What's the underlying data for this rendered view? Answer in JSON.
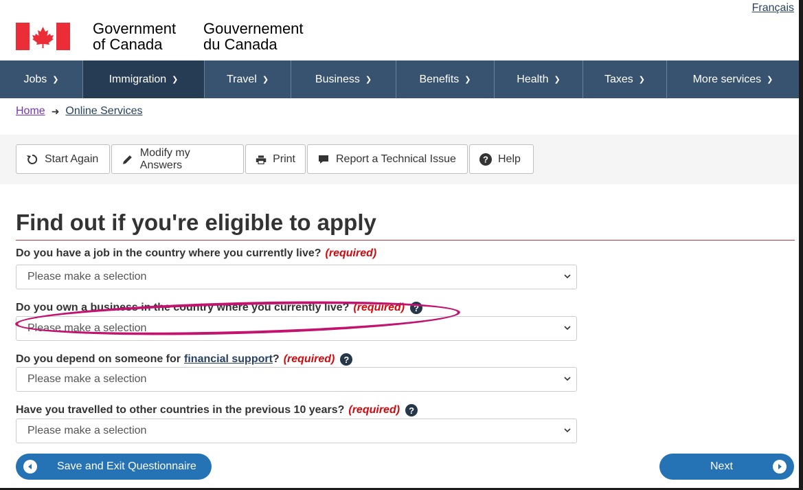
{
  "header": {
    "language_toggle": "Français",
    "signature_en_line1": "Government",
    "signature_en_line2": "of Canada",
    "signature_fr_line1": "Gouvernement",
    "signature_fr_line2": "du Canada"
  },
  "nav": {
    "items": [
      {
        "label": "Jobs"
      },
      {
        "label": "Immigration"
      },
      {
        "label": "Travel"
      },
      {
        "label": "Business"
      },
      {
        "label": "Benefits"
      },
      {
        "label": "Health"
      },
      {
        "label": "Taxes"
      },
      {
        "label": "More services"
      }
    ],
    "active": "Immigration"
  },
  "breadcrumb": {
    "home": "Home",
    "online_services": "Online Services"
  },
  "toolbar": {
    "start_again": "Start Again",
    "modify": "Modify my Answers",
    "print": "Print",
    "report": "Report a Technical Issue",
    "help": "Help"
  },
  "page": {
    "title": "Find out if you're eligible to apply"
  },
  "questions": [
    {
      "text": "Do you have a job in the country where you currently live?",
      "required": "(required)",
      "select": "Please make a selection"
    },
    {
      "text": "Do you own a business in the country where you currently live?",
      "required": "(required)",
      "select": "Please make a selection"
    },
    {
      "text_before": "Do you depend on someone for",
      "link": "financial support",
      "text_after": "?",
      "required": "(required)",
      "select": "Please make a selection"
    },
    {
      "text": "Have you travelled to other countries in the previous 10 years?",
      "required": "(required)",
      "select": "Please make a selection"
    }
  ],
  "footer_buttons": {
    "save_exit": "Save and Exit Questionnaire",
    "next": "Next"
  },
  "colors": {
    "nav_bg": "#38536f",
    "nav_active": "#263c55",
    "primary_button": "#2572b4",
    "required": "#d3080c",
    "annotation": "#c2136e",
    "flag_red": "#eb2d37"
  }
}
